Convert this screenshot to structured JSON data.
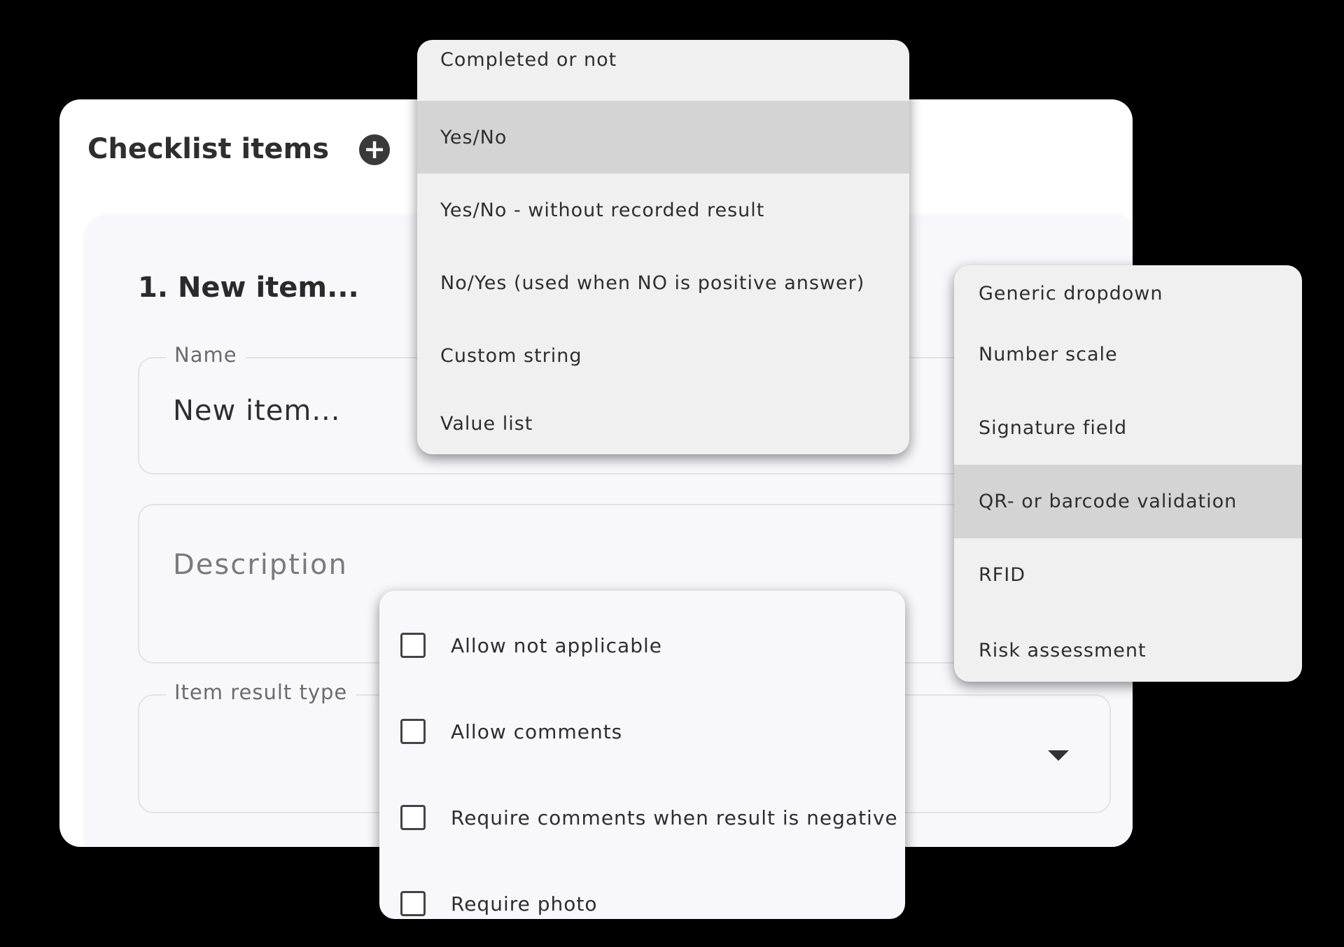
{
  "checklist": {
    "title": "Checklist items",
    "add_icon": "plus-circle-icon"
  },
  "item": {
    "heading": "1. New item...",
    "name_field": {
      "label": "Name",
      "value": "New item..."
    },
    "description_field": {
      "placeholder": "Description"
    },
    "result_type_field": {
      "label": "Item result type",
      "icon": "caret-down-icon"
    }
  },
  "result_type_menu": {
    "items": [
      {
        "label": "Completed or not",
        "selected": false
      },
      {
        "label": "Yes/No",
        "selected": true
      },
      {
        "label": "Yes/No - without recorded result",
        "selected": false
      },
      {
        "label": "No/Yes (used when NO is positive answer)",
        "selected": false
      },
      {
        "label": "Custom string",
        "selected": false
      },
      {
        "label": "Value list",
        "selected": false
      }
    ]
  },
  "result_type_menu_more": {
    "items": [
      {
        "label": "Generic dropdown",
        "selected": false
      },
      {
        "label": "Number scale",
        "selected": false
      },
      {
        "label": "Signature field",
        "selected": false
      },
      {
        "label": "QR- or barcode validation",
        "selected": true
      },
      {
        "label": "RFID",
        "selected": false
      },
      {
        "label": "Risk assessment",
        "selected": false
      }
    ]
  },
  "options": {
    "items": [
      {
        "label": "Allow not applicable",
        "checked": false
      },
      {
        "label": "Allow comments",
        "checked": false
      },
      {
        "label": "Require comments when result is negative",
        "checked": false
      },
      {
        "label": "Require photo",
        "checked": false
      }
    ]
  },
  "colors": {
    "background": "#000000",
    "card": "#ffffff",
    "menu": "#f0f0f0",
    "menu_selected": "#d4d4d4",
    "text": "#2e2e2e"
  }
}
